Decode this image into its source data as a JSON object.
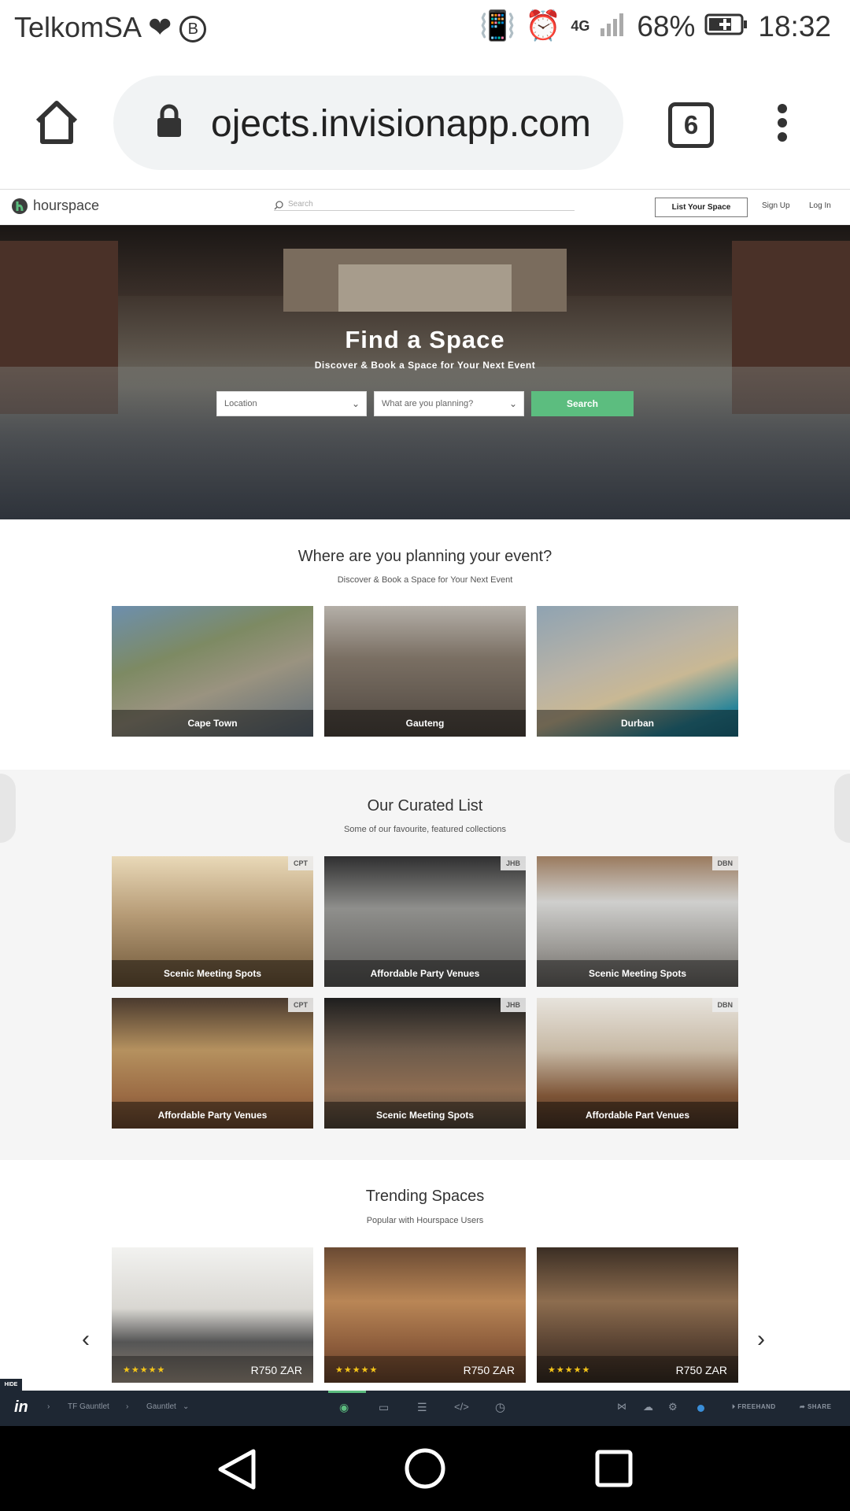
{
  "status_bar": {
    "carrier": "TelkomSA",
    "network": "4G",
    "battery": "68%",
    "time": "18:32"
  },
  "browser": {
    "url": "ojects.invisionapp.com",
    "tab_count": "6"
  },
  "site_header": {
    "logo": "hourspace",
    "search_placeholder": "Search",
    "list_space": "List Your Space",
    "sign_up": "Sign Up",
    "log_in": "Log In"
  },
  "hero": {
    "title": "Find a Space",
    "subtitle": "Discover & Book a Space for Your Next Event",
    "location_placeholder": "Location",
    "planning_placeholder": "What are you planning?",
    "search_button": "Search"
  },
  "cities": {
    "title": "Where are you planning your event?",
    "subtitle": "Discover & Book a Space for Your Next Event",
    "items": [
      {
        "label": "Cape Town"
      },
      {
        "label": "Gauteng"
      },
      {
        "label": "Durban"
      }
    ]
  },
  "curated": {
    "title": "Our Curated List",
    "subtitle": "Some of our favourite, featured collections",
    "items": [
      {
        "label": "Scenic Meeting Spots",
        "tag": "CPT"
      },
      {
        "label": "Affordable Party Venues",
        "tag": "JHB"
      },
      {
        "label": "Scenic Meeting Spots",
        "tag": "DBN"
      },
      {
        "label": "Affordable Party Venues",
        "tag": "CPT"
      },
      {
        "label": "Scenic Meeting Spots",
        "tag": "JHB"
      },
      {
        "label": "Affordable Part Venues",
        "tag": "DBN"
      }
    ]
  },
  "trending": {
    "title": "Trending Spaces",
    "subtitle": "Popular with Hourspace Users",
    "items": [
      {
        "stars": "★★★★★",
        "price": "R750 ZAR"
      },
      {
        "stars": "★★★★★",
        "price": "R750 ZAR"
      },
      {
        "stars": "★★★★★",
        "price": "R750 ZAR"
      }
    ]
  },
  "invision": {
    "hide": "HIDE",
    "logo": "in",
    "project": "TF Gauntlet",
    "screen": "Gauntlet",
    "freehand": "FREEHAND",
    "share": "SHARE"
  },
  "colors": {
    "accent_green": "#5cbd7f",
    "toolbar": "#1e2733"
  }
}
